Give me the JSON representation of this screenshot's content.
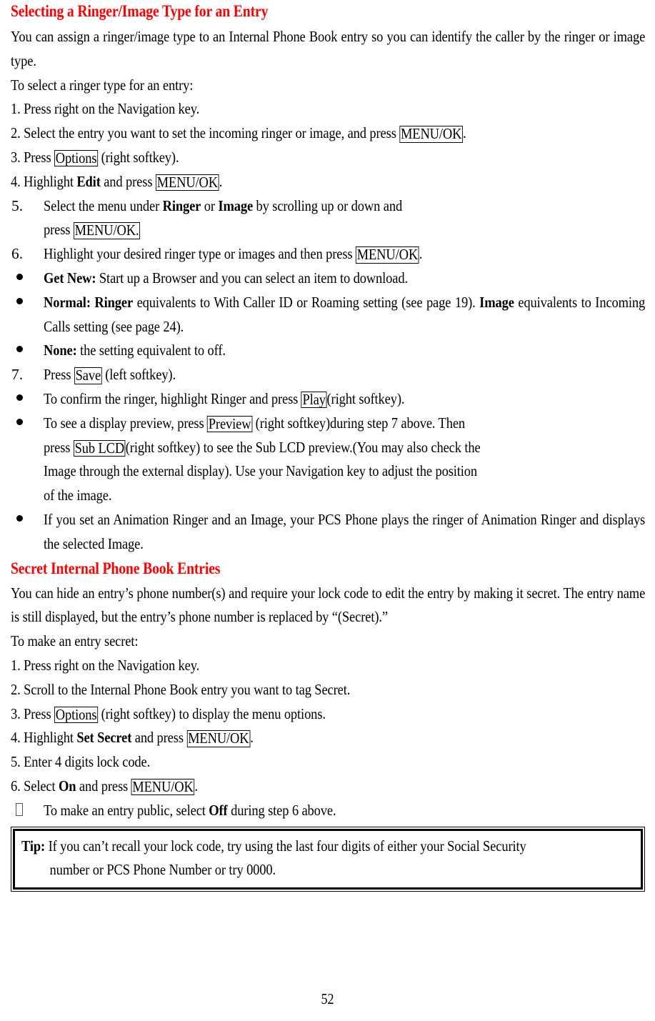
{
  "page": {
    "number": "52"
  },
  "sections": [
    {
      "heading": "Selecting a Ringer/Image Type for an Entry",
      "intro_p1_a": "You can assign a ringer/image type to an Internal Phone Book entry so you can identify the caller by the ringer or image type.",
      "intro_p2": "To select a ringer type for an entry:"
    },
    {
      "heading": "Secret Internal Phone Book Entries",
      "intro_p1": "You can hide an entry’s phone number(s) and require your lock code to edit the entry by making it secret. The entry name is still displayed, but the entry’s phone number is replaced by “(Secret).”",
      "intro_p2": "To make an entry secret:"
    }
  ],
  "steps1": {
    "s1": {
      "num": "1.",
      "text": "Press right on the Navigation key."
    },
    "s2": {
      "num": "2.",
      "pre": "Select the entry you want to set the incoming ringer or image, and press ",
      "key": "MENU/OK",
      "post": "."
    },
    "s3": {
      "num": "3.",
      "pre": "Press ",
      "key": "Options",
      "post": " (right softkey)."
    },
    "s4": {
      "num": "4.",
      "pre": "Highlight ",
      "bold": "Edit",
      "mid": " and press ",
      "key": "MENU/OK",
      "post": "."
    },
    "s5": {
      "num": "5.",
      "pre": "Select the menu under ",
      "bold1": "Ringer",
      "mid1": " or ",
      "bold2": "Image",
      "mid2": " by scrolling up or down and",
      "line2_pre": "press ",
      "line2_key": "MENU/OK."
    },
    "s6": {
      "num": "6.",
      "pre": "Highlight your desired ringer type or images and then press ",
      "key": "MENU/OK",
      "post": "."
    },
    "s7": {
      "num": "7.",
      "pre": "Press ",
      "key": "Save",
      "post": " (left softkey)."
    }
  },
  "bullets1": [
    {
      "bold": "Get New:",
      "text": " Start up a Browser and you can select an item to download."
    },
    {
      "bold1": "Normal: Ringer",
      "t1": " equivalents to With Caller ID or Roaming setting (see page 19). ",
      "bold2": "Image",
      "t2": " equivalents to Incoming Calls setting (see page 24)."
    },
    {
      "bold": "None:",
      "text": " the setting equivalent to off."
    }
  ],
  "bullets2": [
    {
      "pre": "To confirm the ringer, highlight Ringer and press ",
      "key": "Play",
      "post": "(right softkey)."
    },
    {
      "l1_pre": "To see a display preview, press ",
      "l1_key": "Preview",
      "l1_post": " (right softkey)during step 7 above. Then",
      "l2_pre": "press ",
      "l2_key": "Sub LCD",
      "l2_post": "(right softkey) to see the Sub LCD preview.(You may also check the",
      "l3": "Image through the external display). Use your Navigation key to adjust the position",
      "l4": "of the image."
    },
    {
      "text": "If you set an Animation Ringer and an Image, your PCS Phone plays the ringer of Animation Ringer and displays the selected Image."
    }
  ],
  "steps2": {
    "s1": {
      "num": "1.",
      "text": "Press right on the Navigation key."
    },
    "s2": {
      "num": "2.",
      "text": "Scroll to the Internal Phone Book entry you want to tag Secret."
    },
    "s3": {
      "num": "3.",
      "pre": "Press ",
      "key": "Options",
      "post": " (right softkey) to display the menu options."
    },
    "s4": {
      "num": "4.",
      "pre": "Highlight ",
      "bold": "Set Secret",
      "mid": " and press ",
      "key": "MENU/OK",
      "post": "."
    },
    "s5": {
      "num": "5.",
      "text": "Enter 4 digits lock code."
    },
    "s6": {
      "num": "6.",
      "pre": "Select ",
      "bold": "On",
      "mid": " and press ",
      "key": "MENU/OK",
      "post": "."
    },
    "note": {
      "pre": "To make an entry public, select ",
      "bold": "Off",
      "post": " during step 6 above."
    }
  },
  "tip": {
    "label": "Tip:",
    "line1": " If you can’t recall your lock code, try using the last four digits of either your Social Security",
    "line2": "number or PCS Phone Number or try 0000."
  },
  "colors": {
    "heading_red": "#FF0000",
    "text_black": "#000000",
    "page_bg": "#FFFFFF"
  }
}
